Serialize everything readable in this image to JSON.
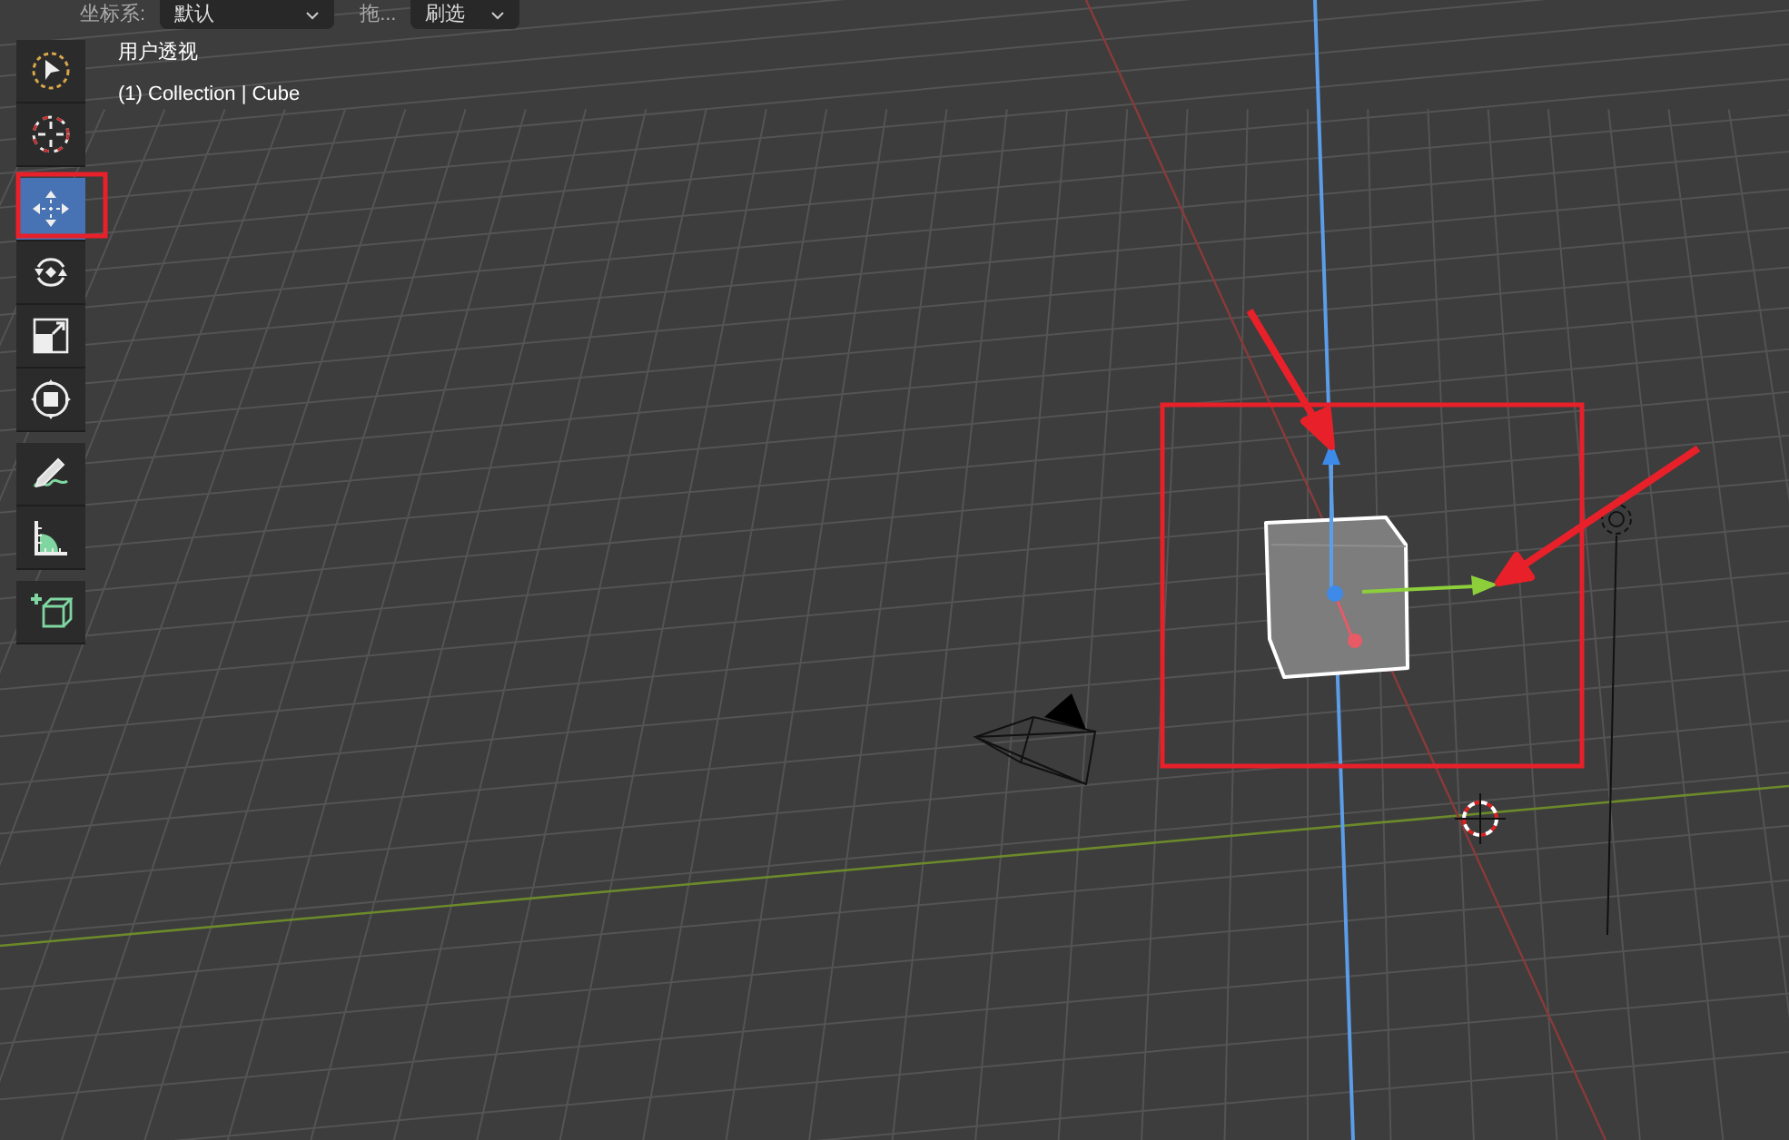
{
  "header": {
    "orientation_label": "坐标系:",
    "orientation_value": "默认",
    "drag_label": "拖...",
    "drag_value": "刷选"
  },
  "viewport": {
    "view_name": "用户透视",
    "object_info": "(1) Collection | Cube"
  },
  "toolbar": {
    "groups": [
      {
        "tools": [
          {
            "kind": "select",
            "selected": false
          },
          {
            "kind": "cursor",
            "selected": false
          }
        ]
      },
      {
        "tools": [
          {
            "kind": "move",
            "selected": true
          },
          {
            "kind": "rotate",
            "selected": false
          },
          {
            "kind": "scale",
            "selected": false
          },
          {
            "kind": "transform",
            "selected": false
          }
        ]
      },
      {
        "tools": [
          {
            "kind": "annotate",
            "selected": false
          },
          {
            "kind": "measure",
            "selected": false
          }
        ]
      },
      {
        "tools": [
          {
            "kind": "add_cube",
            "selected": false
          }
        ]
      }
    ]
  }
}
